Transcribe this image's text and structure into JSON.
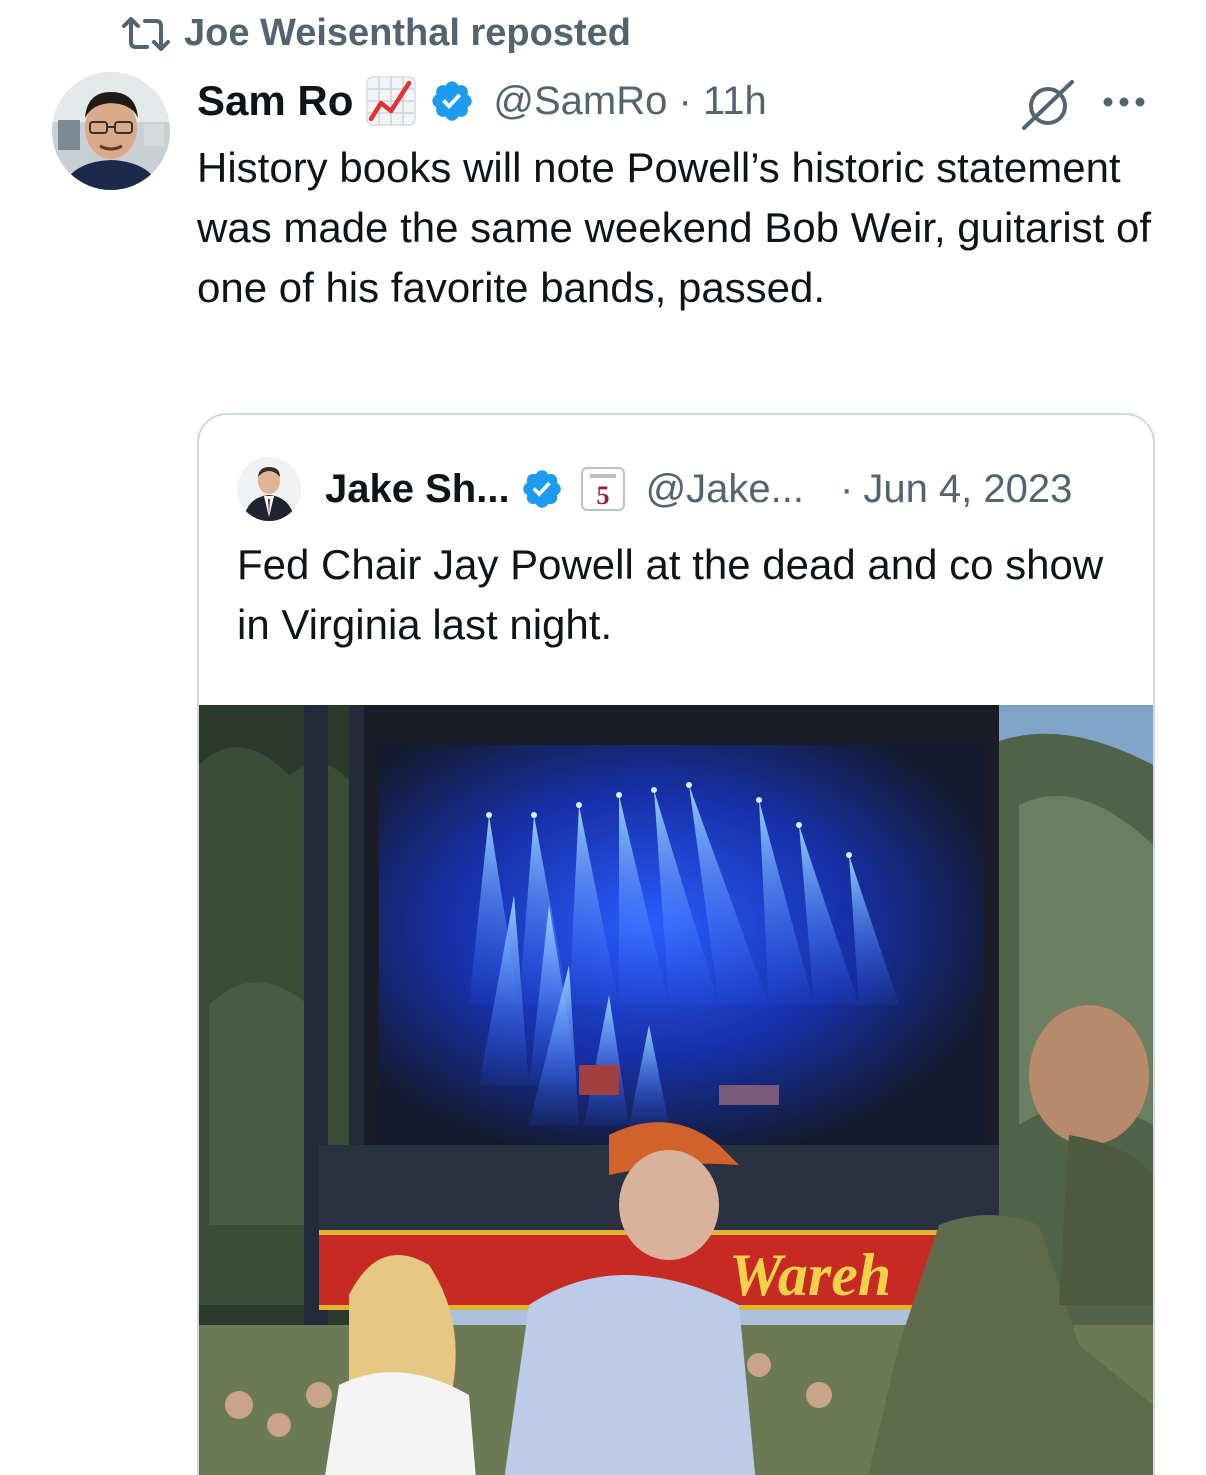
{
  "repost": {
    "label": "Joe Weisenthal reposted"
  },
  "tweet": {
    "author_name": "Sam Ro",
    "author_handle": "@SamRo",
    "separator": "·",
    "time": "11h",
    "text": "History books will note Powell’s historic statement was made the same weekend Bob Weir, guitarist of one of his favorite bands, passed."
  },
  "quote": {
    "author_name": "Jake Sh...",
    "author_handle": "@Jake...",
    "separator": "·",
    "date": "Jun 4, 2023",
    "text": "Fed Chair Jay Powell at the dead and co show in Virginia last night.",
    "badge_number": "5",
    "photo_banner_text": "Wareh"
  },
  "icons": {
    "repost": "repost-icon",
    "verified": "verified-badge-icon",
    "chart": "chart-increasing-emoji",
    "grok": "grok-icon",
    "more": "more-options-icon"
  },
  "colors": {
    "text_primary": "#0f1419",
    "text_secondary": "#536471",
    "verified_blue": "#1d9bf0",
    "border": "#cfd9de"
  }
}
